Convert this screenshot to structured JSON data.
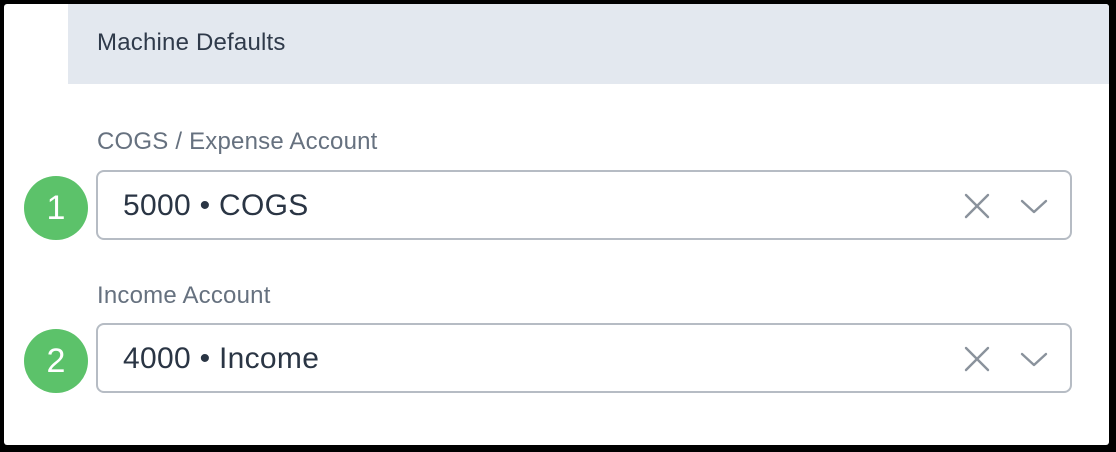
{
  "section": {
    "title": "Machine Defaults"
  },
  "fields": [
    {
      "label": "COGS / Expense Account",
      "value": "5000 • COGS",
      "clear_icon": "close-x-icon",
      "dropdown_icon": "chevron-down-icon"
    },
    {
      "label": "Income Account",
      "value": "4000 • Income",
      "clear_icon": "close-x-icon",
      "dropdown_icon": "chevron-down-icon"
    }
  ],
  "annotations": [
    {
      "number": "1"
    },
    {
      "number": "2"
    }
  ],
  "colors": {
    "header_bg": "#e3e8ef",
    "badge_bg": "#5cc26a",
    "border": "#b6bcc4",
    "label_text": "#66717f",
    "value_text": "#2a3544",
    "icon": "#8a929c"
  }
}
